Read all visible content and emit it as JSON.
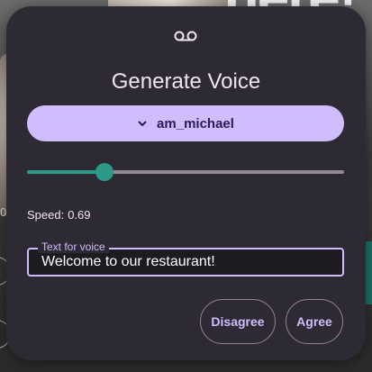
{
  "dialog": {
    "icon": "voicemail-icon",
    "title": "Generate Voice",
    "voice_select": {
      "value": "am_michael",
      "icon": "chevron-down-icon"
    },
    "speed": {
      "label": "Speed:",
      "value": "0.69",
      "fraction": 0.245
    },
    "text_field": {
      "label": "Text for voice",
      "value": "Welcome to our restaurant!"
    },
    "buttons": {
      "disagree": "Disagree",
      "agree": "Agree"
    }
  },
  "background": {
    "heading_fragment": "here!",
    "left_fragment": "0"
  },
  "colors": {
    "dialog_bg": "#2e2a33",
    "primary": "#cfbdfd",
    "slider_active": "#2a9a86",
    "slider_inactive": "#908b95",
    "text": "#ece6f0"
  }
}
